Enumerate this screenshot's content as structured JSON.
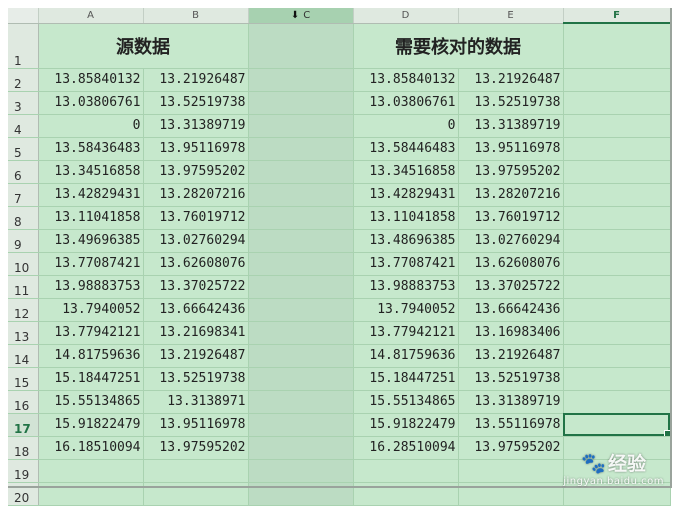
{
  "columns": [
    "A",
    "B",
    "C",
    "D",
    "E",
    "F"
  ],
  "row_numbers": [
    "1",
    "2",
    "3",
    "4",
    "5",
    "6",
    "7",
    "8",
    "9",
    "10",
    "11",
    "12",
    "13",
    "14",
    "15",
    "16",
    "17",
    "18",
    "19",
    "20"
  ],
  "headers": {
    "source": "源数据",
    "check": "需要核对的数据"
  },
  "source": {
    "A": [
      "13.85840132",
      "13.03806761",
      "0",
      "13.58436483",
      "13.34516858",
      "13.42829431",
      "13.11041858",
      "13.49696385",
      "13.77087421",
      "13.98883753",
      "13.7940052",
      "13.77942121",
      "14.81759636",
      "15.18447251",
      "15.55134865",
      "15.91822479",
      "16.18510094"
    ],
    "B": [
      "13.21926487",
      "13.52519738",
      "13.31389719",
      "13.95116978",
      "13.97595202",
      "13.28207216",
      "13.76019712",
      "13.02760294",
      "13.62608076",
      "13.37025722",
      "13.66642436",
      "13.21698341",
      "13.21926487",
      "13.52519738",
      "13.3138971",
      "13.95116978",
      "13.97595202"
    ]
  },
  "check": {
    "D": [
      "13.85840132",
      "13.03806761",
      "0",
      "13.58446483",
      "13.34516858",
      "13.42829431",
      "13.11041858",
      "13.48696385",
      "13.77087421",
      "13.98883753",
      "13.7940052",
      "13.77942121",
      "14.81759636",
      "15.18447251",
      "15.55134865",
      "15.91822479",
      "16.28510094"
    ],
    "E": [
      "13.21926487",
      "13.52519738",
      "13.31389719",
      "13.95116978",
      "13.97595202",
      "13.28207216",
      "13.76019712",
      "13.02760294",
      "13.62608076",
      "13.37025722",
      "13.66642436",
      "13.16983406",
      "13.21926487",
      "13.52519738",
      "13.31389719",
      "13.55116978",
      "13.97595202"
    ]
  },
  "selection": {
    "selected_column": "C",
    "active_cell": "F17",
    "active_column": "F",
    "active_row": "17"
  },
  "colors": {
    "sheet_background": "#c6e8cc",
    "selection_accent": "#217346"
  },
  "watermark": {
    "brand": "经验",
    "url": "jingyan.baidu.com"
  }
}
